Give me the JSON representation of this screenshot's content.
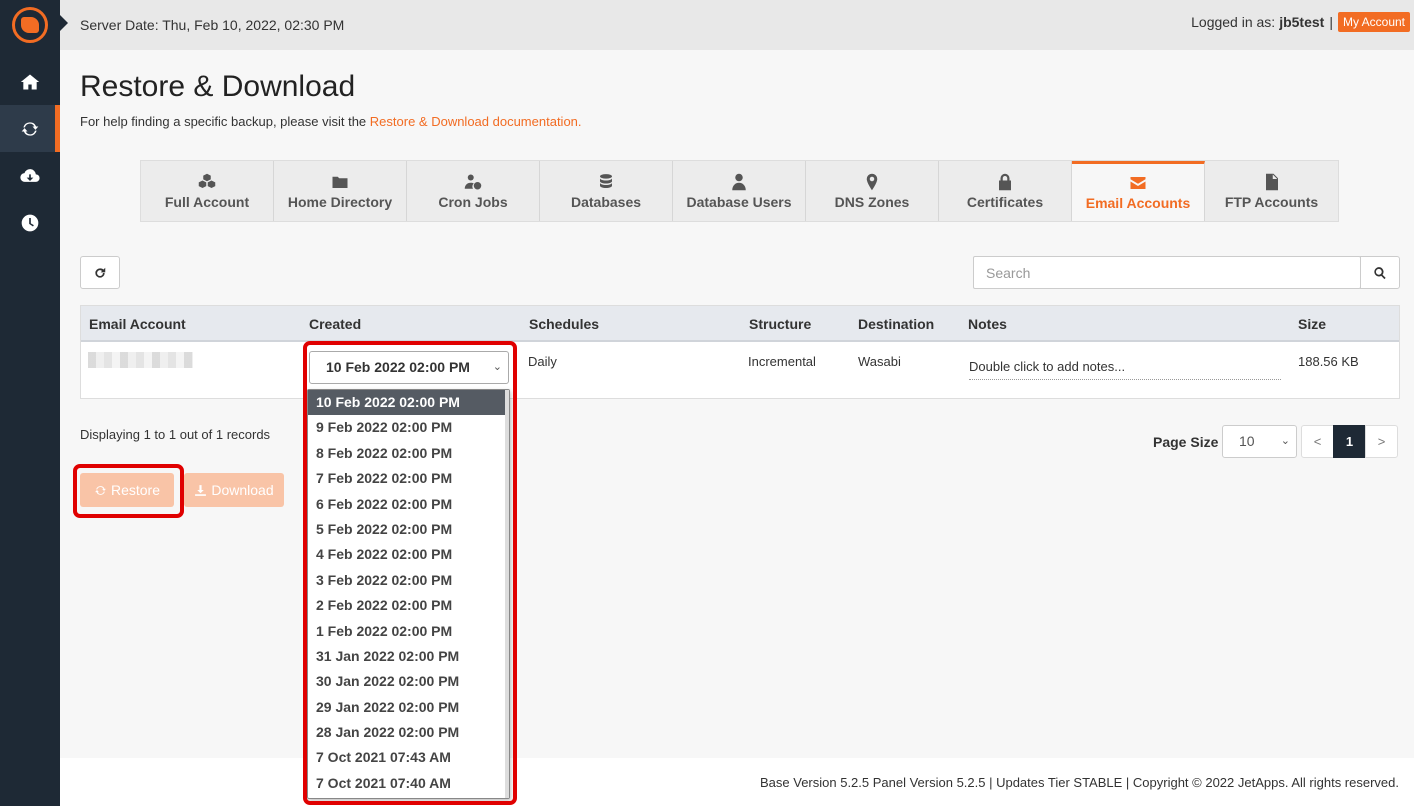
{
  "topbar": {
    "server_date": "Server Date: Thu, Feb 10, 2022, 02:30 PM",
    "logged_in_prefix": "Logged in as:",
    "username": "jb5test",
    "separator": "|",
    "my_account": "My Account"
  },
  "sidebar": {
    "items": [
      {
        "icon": "home-icon"
      },
      {
        "icon": "refresh-icon",
        "active": true
      },
      {
        "icon": "cloud-download-icon"
      },
      {
        "icon": "clock-icon"
      }
    ]
  },
  "page": {
    "title": "Restore & Download",
    "help_text": "For help finding a specific backup, please visit the ",
    "help_link": "Restore & Download documentation."
  },
  "tabs": [
    {
      "label": "Full Account",
      "icon": "cubes-icon"
    },
    {
      "label": "Home Directory",
      "icon": "folder-icon"
    },
    {
      "label": "Cron Jobs",
      "icon": "user-clock-icon"
    },
    {
      "label": "Databases",
      "icon": "database-icon"
    },
    {
      "label": "Database Users",
      "icon": "user-tie-icon"
    },
    {
      "label": "DNS Zones",
      "icon": "map-marker-icon"
    },
    {
      "label": "Certificates",
      "icon": "lock-icon"
    },
    {
      "label": "Email Accounts",
      "icon": "envelope-icon",
      "active": true
    },
    {
      "label": "FTP Accounts",
      "icon": "file-icon"
    }
  ],
  "search": {
    "placeholder": "Search"
  },
  "table": {
    "headers": [
      "Email Account",
      "Created",
      "Schedules",
      "Structure",
      "Destination",
      "Notes",
      "Size"
    ],
    "row": {
      "created": "10 Feb 2022 02:00 PM",
      "schedules": "Daily",
      "structure": "Incremental",
      "destination": "Wasabi",
      "notes": "Double click to add notes...",
      "size": "188.56 KB"
    }
  },
  "dropdown": {
    "options": [
      "10 Feb 2022 02:00 PM",
      "9 Feb 2022 02:00 PM",
      "8 Feb 2022 02:00 PM",
      "7 Feb 2022 02:00 PM",
      "6 Feb 2022 02:00 PM",
      "5 Feb 2022 02:00 PM",
      "4 Feb 2022 02:00 PM",
      "3 Feb 2022 02:00 PM",
      "2 Feb 2022 02:00 PM",
      "1 Feb 2022 02:00 PM",
      "31 Jan 2022 02:00 PM",
      "30 Jan 2022 02:00 PM",
      "29 Jan 2022 02:00 PM",
      "28 Jan 2022 02:00 PM",
      "7 Oct 2021 07:43 AM",
      "7 Oct 2021 07:40 AM"
    ],
    "selected_index": 0
  },
  "records": "Displaying 1 to 1 out of 1 records",
  "pagination": {
    "page_size_label": "Page Size",
    "page_size_value": "10",
    "prev": "<",
    "current": "1",
    "next": ">"
  },
  "actions": {
    "restore": "Restore",
    "download": "Download"
  },
  "footer": "Base Version 5.2.5 Panel Version 5.2.5 | Updates Tier STABLE | Copyright © 2022 JetApps. All rights reserved.",
  "colors": {
    "accent": "#f26c23",
    "sidebar": "#1e2935",
    "highlight": "#e00000"
  }
}
